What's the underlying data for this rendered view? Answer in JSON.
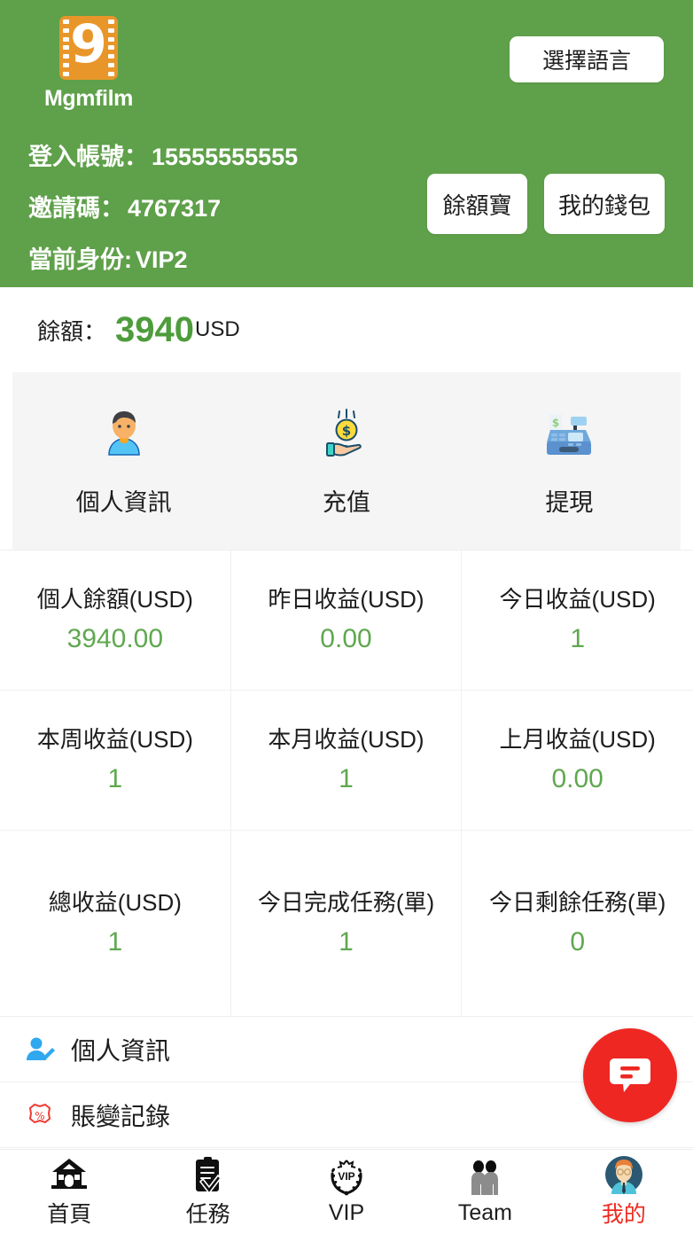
{
  "header": {
    "brand_name": "Mgmfilm",
    "logo_glyph": "9",
    "language_button": "選擇語言",
    "account_label": "登入帳號：",
    "account_value": "15555555555",
    "invite_label": "邀請碼：",
    "invite_value": "4767317",
    "identity_label": "當前身份:",
    "identity_value": "VIP2",
    "yuebao_button": "餘額寶",
    "wallet_button": "我的錢包",
    "bg_color": "#5FA04A"
  },
  "balance": {
    "label": "餘額：",
    "amount": "3940",
    "currency": "USD",
    "color": "#4E9C3C"
  },
  "quick_actions": [
    {
      "icon": "person-avatar-icon",
      "label": "個人資訊"
    },
    {
      "icon": "hand-coin-icon",
      "label": "充值"
    },
    {
      "icon": "cash-register-icon",
      "label": "提現"
    }
  ],
  "stats": [
    {
      "title": "個人餘額(USD)",
      "value": "3940.00"
    },
    {
      "title": "昨日收益(USD)",
      "value": "0.00"
    },
    {
      "title": "今日收益(USD)",
      "value": "1"
    },
    {
      "title": "本周收益(USD)",
      "value": "1"
    },
    {
      "title": "本月收益(USD)",
      "value": "1"
    },
    {
      "title": "上月收益(USD)",
      "value": "0.00"
    },
    {
      "title": "總收益(USD)",
      "value": "1"
    },
    {
      "title": "今日完成任務(單)",
      "value": "1"
    },
    {
      "title": "今日剩餘任務(單)",
      "value": "0"
    }
  ],
  "stats_value_color": "#5FA84F",
  "menu_items": [
    {
      "icon": "user-edit-icon",
      "label": "個人資訊"
    },
    {
      "icon": "percent-tag-icon",
      "label": "賬變記錄"
    }
  ],
  "chat_fab": {
    "icon": "chat-bubble-icon",
    "color": "#EE2722"
  },
  "bottom_nav": {
    "active_color": "#EE2B1F",
    "items": [
      {
        "icon": "home-icon",
        "label": "首頁",
        "active": false
      },
      {
        "icon": "clipboard-check-icon",
        "label": "任務",
        "active": false
      },
      {
        "icon": "vip-wreath-icon",
        "label": "VIP",
        "active": false
      },
      {
        "icon": "team-people-icon",
        "label": "Team",
        "active": false
      },
      {
        "icon": "profile-avatar-icon",
        "label": "我的",
        "active": true
      }
    ]
  }
}
